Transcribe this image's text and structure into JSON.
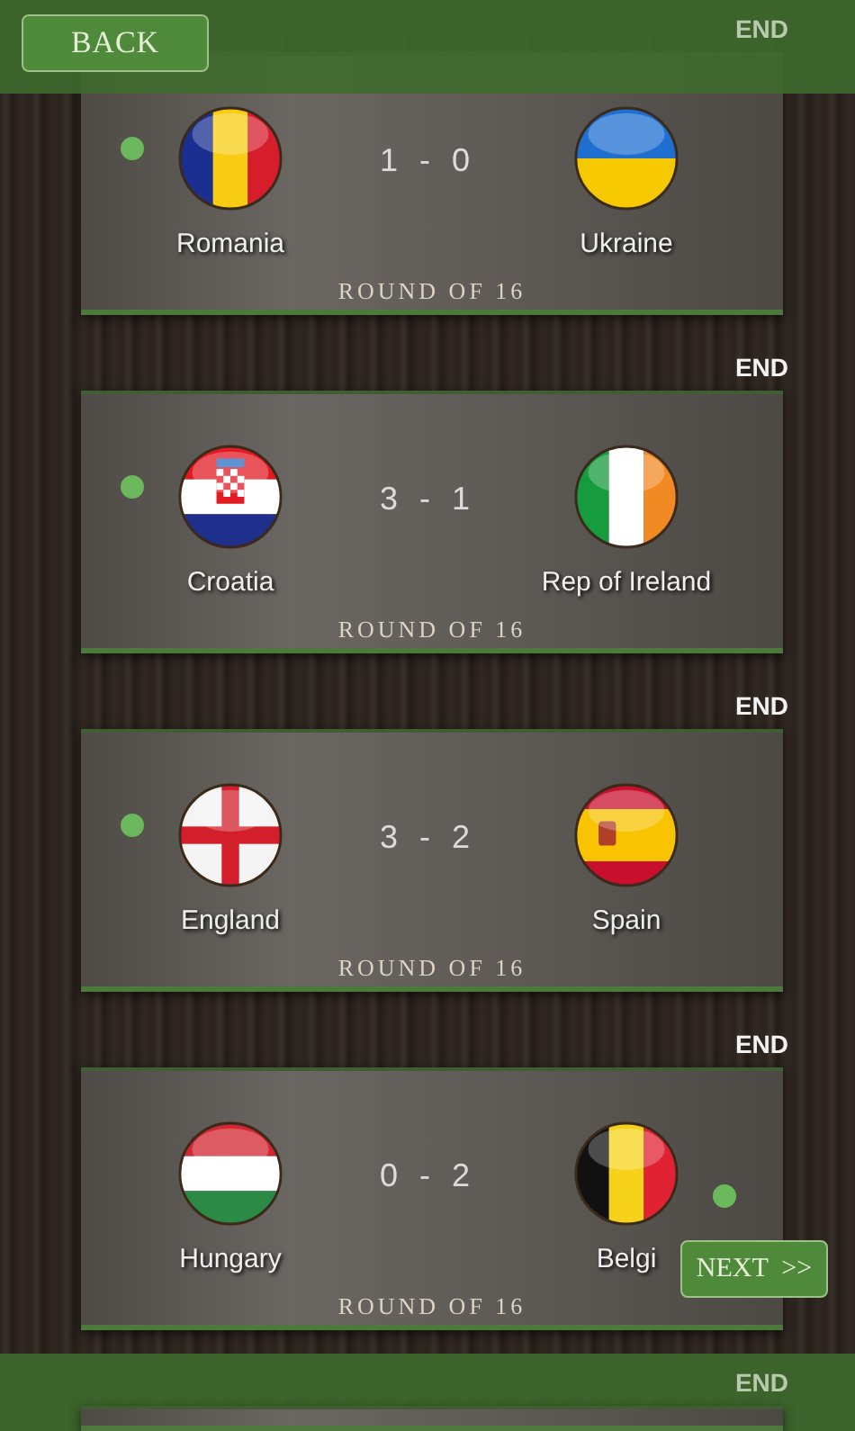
{
  "back_button": "BACK",
  "next_button": "NEXT  >>",
  "matches": [
    {
      "status": "END",
      "home": {
        "name": "Romania",
        "flag": {
          "kind": "romania"
        },
        "winner": true
      },
      "away": {
        "name": "Ukraine",
        "flag": {
          "kind": "ukraine"
        },
        "winner": false
      },
      "score_home": "1",
      "separator": "-",
      "score_away": "0",
      "round": "ROUND OF 16"
    },
    {
      "status": "END",
      "home": {
        "name": "Croatia",
        "flag": {
          "kind": "croatia"
        },
        "winner": true
      },
      "away": {
        "name": "Rep of Ireland",
        "flag": {
          "kind": "ireland"
        },
        "winner": false
      },
      "score_home": "3",
      "separator": "-",
      "score_away": "1",
      "round": "ROUND OF 16"
    },
    {
      "status": "END",
      "home": {
        "name": "England",
        "flag": {
          "kind": "england"
        },
        "winner": true
      },
      "away": {
        "name": "Spain",
        "flag": {
          "kind": "spain"
        },
        "winner": false
      },
      "score_home": "3",
      "separator": "-",
      "score_away": "2",
      "round": "ROUND OF 16"
    },
    {
      "status": "END",
      "home": {
        "name": "Hungary",
        "flag": {
          "kind": "hungary"
        },
        "winner": false
      },
      "away": {
        "name": "Belgi",
        "flag": {
          "kind": "belgium"
        },
        "winner": true
      },
      "score_home": "0",
      "separator": "-",
      "score_away": "2",
      "round": "ROUND OF 16"
    },
    {
      "status": "END"
    }
  ]
}
